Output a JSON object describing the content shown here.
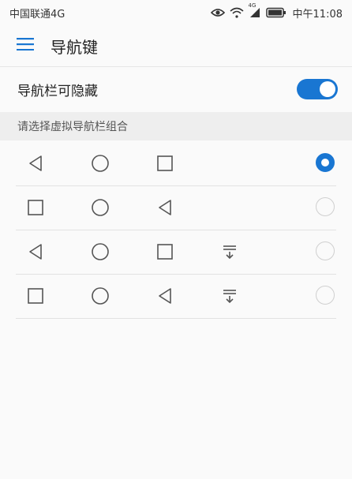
{
  "status_bar": {
    "carrier": "中国联通4G",
    "network_badge": "4G",
    "time": "中午11:08",
    "icons": [
      "eye-icon",
      "wifi-icon",
      "signal-icon",
      "battery-icon"
    ]
  },
  "app_bar": {
    "title": "导航键",
    "menu_icon": "hamburger-menu-icon"
  },
  "toggle": {
    "label": "导航栏可隐藏",
    "enabled": true
  },
  "section": {
    "header": "请选择虚拟导航栏组合"
  },
  "options": [
    {
      "icons": [
        "back-triangle-icon",
        "home-circle-icon",
        "recents-square-icon"
      ],
      "selected": true
    },
    {
      "icons": [
        "recents-square-icon",
        "home-circle-icon",
        "back-triangle-icon"
      ],
      "selected": false
    },
    {
      "icons": [
        "back-triangle-icon",
        "home-circle-icon",
        "recents-square-icon",
        "notification-pulldown-icon"
      ],
      "selected": false
    },
    {
      "icons": [
        "recents-square-icon",
        "home-circle-icon",
        "back-triangle-icon",
        "notification-pulldown-icon"
      ],
      "selected": false
    }
  ],
  "colors": {
    "accent": "#1976d2",
    "background": "#fafafa",
    "section_bg": "#eeeeee",
    "icon_gray": "#555555"
  }
}
